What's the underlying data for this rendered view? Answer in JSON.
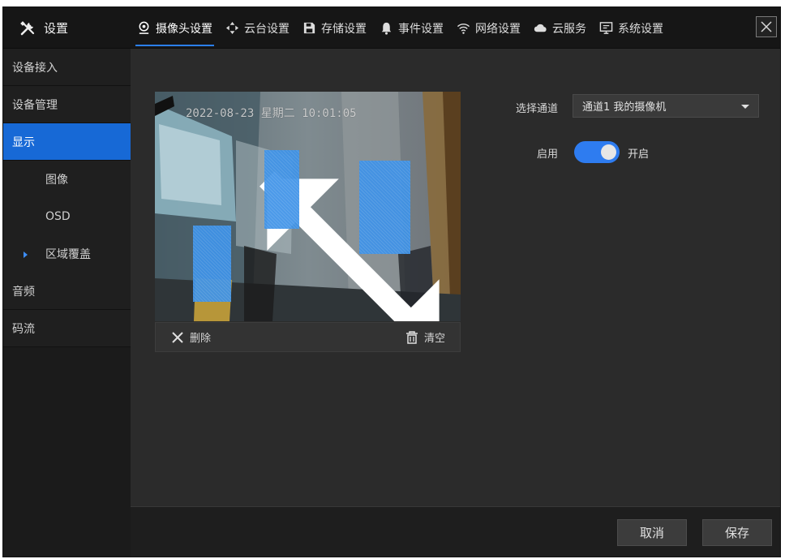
{
  "app": {
    "title": "设置"
  },
  "tabs": [
    {
      "label": "摄像头设置",
      "icon": "camera-pin-icon",
      "active": true
    },
    {
      "label": "云台设置",
      "icon": "ptz-arrows-icon"
    },
    {
      "label": "存储设置",
      "icon": "floppy-disk-icon"
    },
    {
      "label": "事件设置",
      "icon": "bell-icon"
    },
    {
      "label": "网络设置",
      "icon": "wifi-icon"
    },
    {
      "label": "云服务",
      "icon": "cloud-icon"
    },
    {
      "label": "系统设置",
      "icon": "monitor-icon"
    }
  ],
  "sidebar": {
    "items": [
      {
        "label": "设备接入"
      },
      {
        "label": "设备管理"
      },
      {
        "label": "显示",
        "active": true
      },
      {
        "label": "图像"
      },
      {
        "label": "OSD"
      },
      {
        "label": "区域覆盖",
        "current": true
      },
      {
        "label": "音频"
      },
      {
        "label": "码流"
      }
    ]
  },
  "preview": {
    "osd_time": "2022-08-23 星期二 10:01:05",
    "mask_color": "#3f93e8"
  },
  "toolbar": {
    "delete_label": "删除",
    "clear_label": "清空"
  },
  "channel": {
    "label": "选择通道",
    "value": "通道1 我的摄像机"
  },
  "enable": {
    "label": "启用",
    "state": "开启",
    "on": true
  },
  "footer": {
    "cancel_label": "取消",
    "save_label": "保存"
  },
  "colors": {
    "accent": "#1769d6",
    "toggle": "#2e7cf0"
  }
}
